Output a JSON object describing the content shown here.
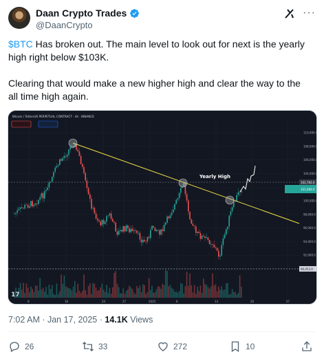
{
  "author": {
    "display_name": "Daan Crypto Trades",
    "handle": "@DaanCrypto",
    "verified": true,
    "badge_color": "#1d9bf0"
  },
  "tweet": {
    "cashtag": "$BTC",
    "line1_rest": " Has broken out. The main level to look out for next is the yearly high right below $103K.",
    "line2": "Clearing that would make a new higher high and clear the way to the all time high again."
  },
  "chart": {
    "symbol_title": "Bitcoin / TetherUS PERPETUAL CONTRACT · 4h · BINANCE",
    "annotation_label": "Yearly High",
    "price_axis": [
      "110,000.0",
      "108,000.0",
      "106,000.0",
      "104,000.0",
      "102,000.0",
      "100,000.0",
      "98,000.0",
      "96,000.0",
      "94,000.0",
      "92,000.0",
      "90,000.0"
    ],
    "level_badges": {
      "yearly_high": "102,783.0",
      "current_price": "101,066.0",
      "lower_level": "90,053.0"
    },
    "time_axis": [
      "9",
      "16",
      "23",
      "27",
      "2025",
      "6",
      "13",
      "20",
      "27"
    ],
    "colors": {
      "up": "#26a69a",
      "down": "#ef5350",
      "trendline": "#f0e046",
      "background": "#131722"
    }
  },
  "meta": {
    "timestamp": "7:02 AM · Jan 17, 2025",
    "separator": " · ",
    "views_count": "14.1K",
    "views_label": " Views"
  },
  "actions": {
    "replies": "26",
    "reposts": "33",
    "likes": "272",
    "bookmarks": "10"
  }
}
